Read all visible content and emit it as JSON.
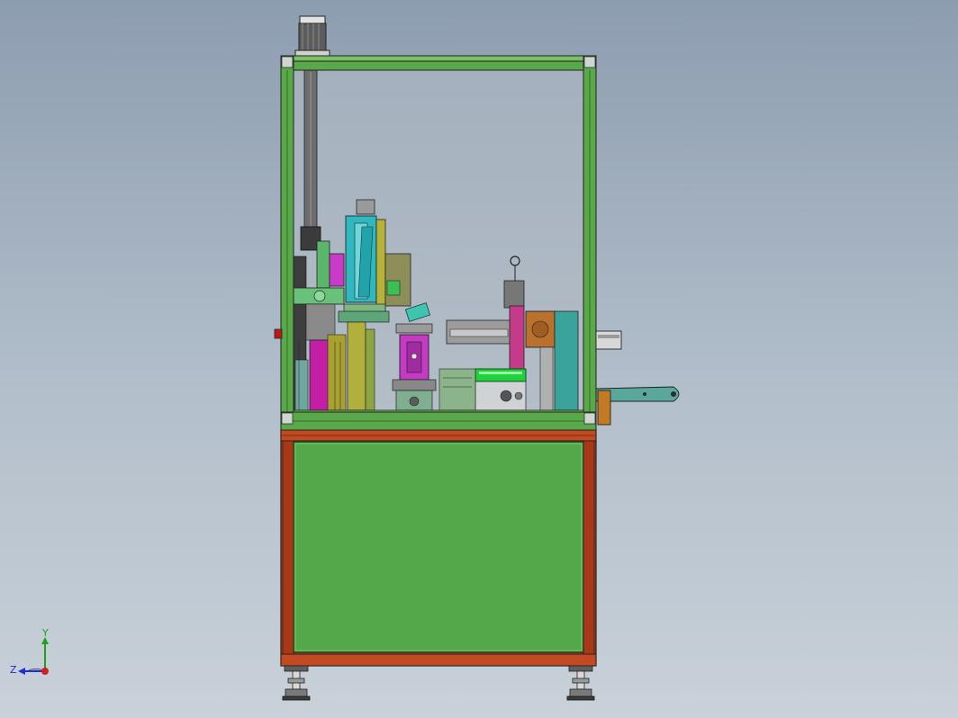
{
  "viewport": {
    "background_top": "#8d9db0",
    "background_bottom": "#c9d1d9",
    "frame_color": "#5aa84a",
    "frame_dark": "#2f6f2a",
    "base_frame_color": "#b8401c",
    "base_panel_color": "#55a84a",
    "edge_color": "#222222"
  },
  "triad": {
    "y_label": "Y",
    "z_label": "Z",
    "y_color": "#1fa01f",
    "z_color": "#2030d0",
    "x_color": "#d02020"
  },
  "parts": {
    "motor": "motor",
    "lead_screw": "lead-screw",
    "cylinder": "cylinder-unit",
    "feeder": "feeder-arm",
    "stop_button": "emergency-stop"
  }
}
